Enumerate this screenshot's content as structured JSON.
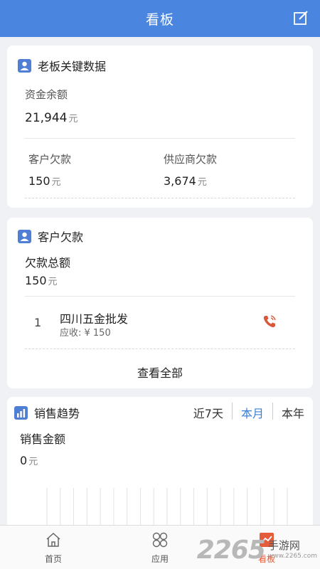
{
  "header": {
    "title": "看板",
    "edit_icon": "edit-icon"
  },
  "boss_card": {
    "title": "老板关键数据",
    "fund_label": "资金余额",
    "fund_value": "21,944",
    "fund_unit": "元",
    "customer_debt_label": "客户欠款",
    "customer_debt_value": "150",
    "customer_debt_unit": "元",
    "supplier_debt_label": "供应商欠款",
    "supplier_debt_value": "3,674",
    "supplier_debt_unit": "元"
  },
  "customer_card": {
    "title": "客户欠款",
    "total_label": "欠款总额",
    "total_value": "150",
    "total_unit": "元",
    "rows": [
      {
        "index": "1",
        "name": "四川五金批发",
        "receivable": "应收: ¥ 150"
      }
    ],
    "view_all": "查看全部"
  },
  "sales_card": {
    "title": "销售趋势",
    "ranges": [
      "近7天",
      "本月",
      "本年"
    ],
    "active_range": "本月",
    "sales_label": "销售金额",
    "sales_value": "0",
    "sales_unit": "元"
  },
  "tabbar": {
    "items": [
      {
        "label": "首页",
        "icon": "home-icon"
      },
      {
        "label": "应用",
        "icon": "apps-icon"
      },
      {
        "label": "看板",
        "icon": "dashboard-icon"
      }
    ],
    "active": "看板"
  },
  "watermark": {
    "number": "2265",
    "text": "手游网",
    "url": "www.2265.com"
  },
  "colors": {
    "header": "#4a86e0",
    "accent": "#3a7fd6",
    "active_tab": "#e45c3a",
    "icon_blue": "#4e7fd5"
  }
}
